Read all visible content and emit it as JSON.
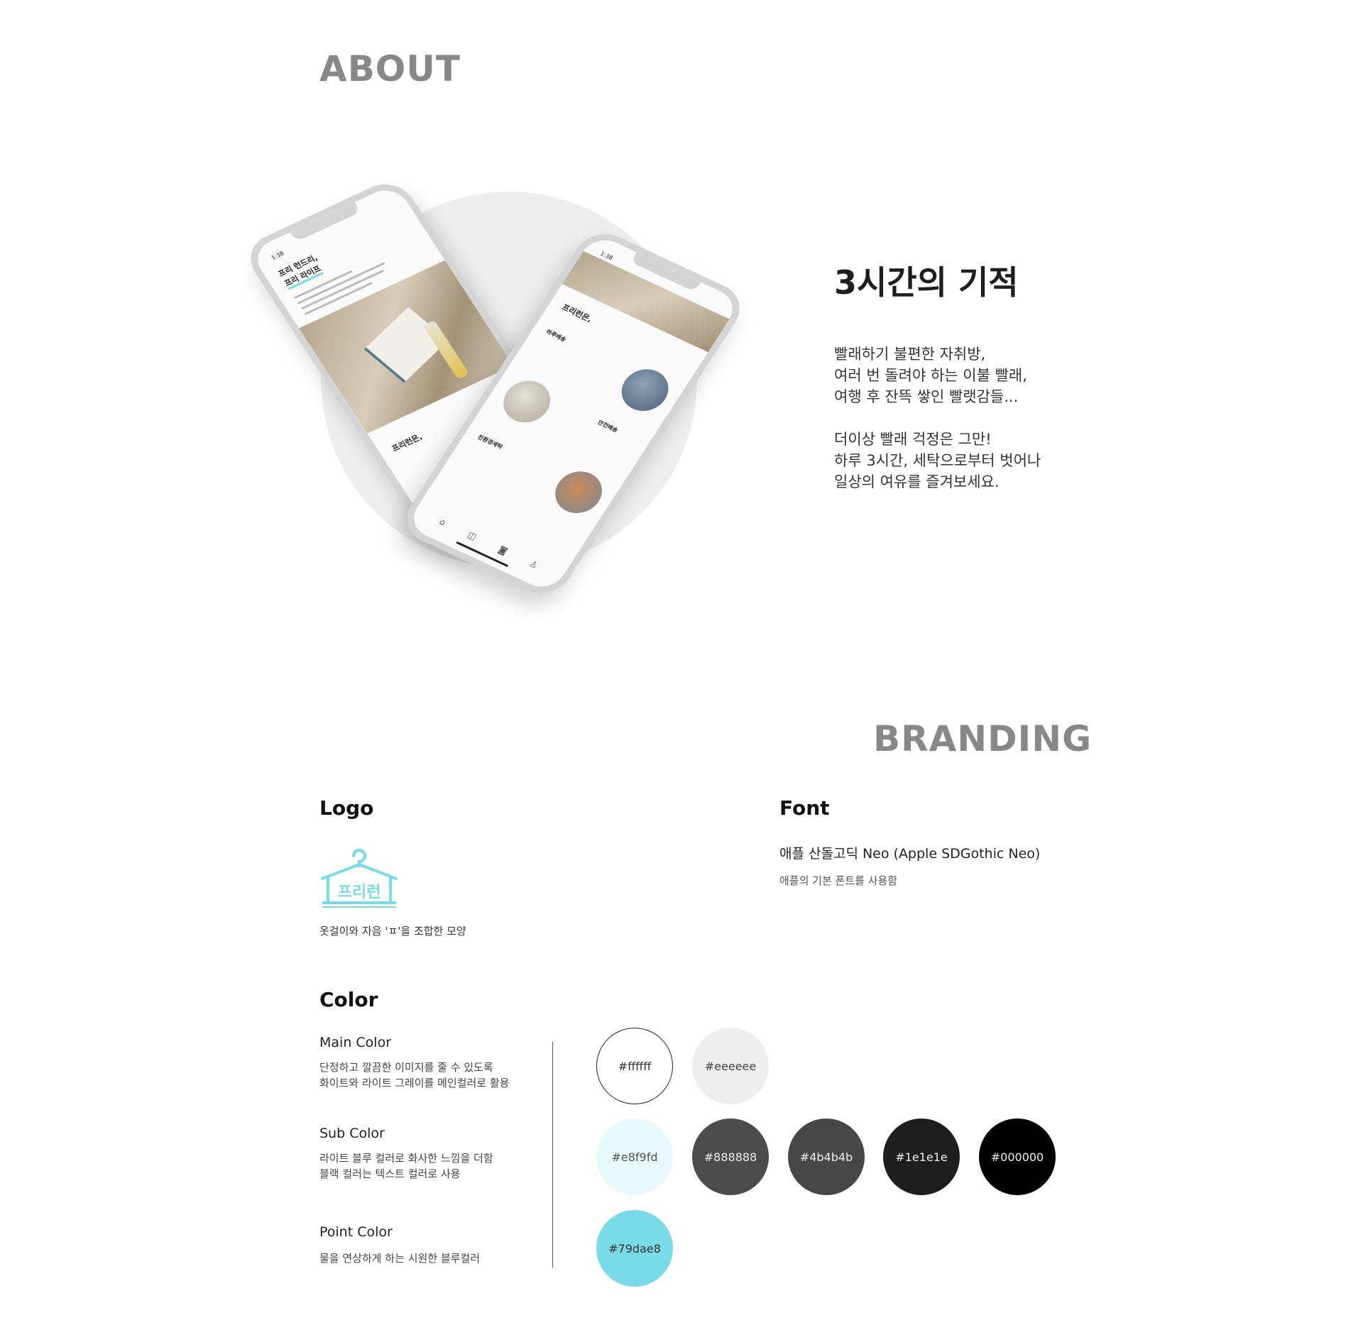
{
  "about": {
    "title": "ABOUT",
    "headline": "3시간의 기적",
    "desc": [
      "빨래하기 불편한 자취방,",
      "여러 번 돌려야 하는 이불 빨래,",
      "여행 후 잔뜩 쌓인 빨랫감들...",
      "더이상 빨래 걱정은 그만!",
      "하루 3시간, 세탁으로부터 벗어나",
      "일상의 여유를 즐겨보세요."
    ]
  },
  "mockup": {
    "back": {
      "time": "1:38",
      "headline_1": "프리 런드리,",
      "headline_2": "프리 라이프",
      "sub": "프리런은,"
    },
    "front": {
      "time": "1:38",
      "title": "프리런은,",
      "item_1": "하루배송",
      "item_2": "안전배송",
      "item_3": "친환경세탁"
    }
  },
  "branding": {
    "title": "BRANDING",
    "logo": {
      "title": "Logo",
      "mark_text": "프리런",
      "desc": "옷걸이와 자음 'ㅍ'을 조합한 모양"
    },
    "font": {
      "title": "Font",
      "name": "애플 산돌고딕  Neo (Apple SDGothic Neo)",
      "desc": "애플의 기본 폰트를 사용함"
    },
    "color": {
      "title": "Color",
      "main_label": "Main Color",
      "main_desc_1": "단정하고 깔끔한 이미지를 줄 수 있도록",
      "main_desc_2": "화이트와 라이트 그레이를 메인컬러로 활용",
      "sub_label": "Sub Color",
      "sub_desc_1": "라이트 블루 컬러로 화사한 느낌을 더함",
      "sub_desc_2": "블랙 컬러는 텍스트 컬러로 사용",
      "point_label": "Point Color",
      "point_desc": "물을 연상하게 하는 시원한 블루컬러",
      "swatches": {
        "main": [
          "#ffffff",
          "#eeeeee"
        ],
        "sub": [
          "#e8f9fd",
          "#888888",
          "#4b4b4b",
          "#1e1e1e",
          "#000000"
        ],
        "point": [
          "#79dae8"
        ]
      }
    }
  },
  "colors": {
    "accent": "#79dae8",
    "heading_gray": "#888888",
    "text": "#1e1e1e"
  }
}
